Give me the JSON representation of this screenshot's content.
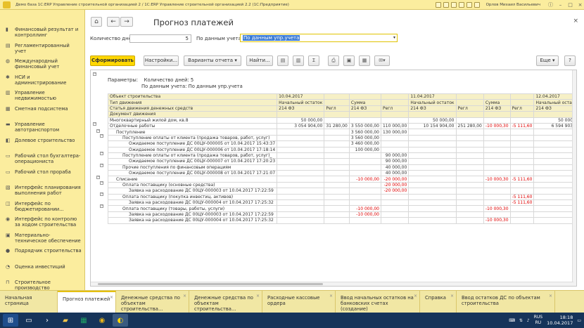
{
  "window": {
    "title": "Демо база 1С:ERP Управление строительной организацией 2 / 1С:ERP Управление строительной организацией 2.2 (1С:Предприятие)",
    "user": "Орлов Михаил Васильевич"
  },
  "sidebar": {
    "items": [
      {
        "label": "Финансовый результат и контроллинг",
        "icon": "chart-icon"
      },
      {
        "label": "Регламентированный учет",
        "icon": "ledger-icon"
      },
      {
        "label": "Международный финансовый учет",
        "icon": "globe-icon"
      },
      {
        "label": "НСИ и администрирование",
        "icon": "gear-icon"
      },
      {
        "label": "Управление недвижимостью",
        "icon": "building-icon"
      },
      {
        "label": "Сметная подсистема",
        "icon": "estimate-icon"
      },
      {
        "label": "Управление автотранспортом",
        "icon": "truck-icon"
      },
      {
        "label": "Долевое строительство",
        "icon": "share-icon"
      },
      {
        "label": "Рабочий стол бухгалтера-операциониста",
        "icon": "desk-icon"
      },
      {
        "label": "Рабочий стол прораба",
        "icon": "desk-icon"
      },
      {
        "label": "Интерфейс планирования выполнения работ",
        "icon": "plan-icon"
      },
      {
        "label": "Интерфейс по бюджетировании...",
        "icon": "budget-icon"
      },
      {
        "label": "Интерфейс по контролю за ходом строительства",
        "icon": "control-icon"
      },
      {
        "label": "Материально-техническое обеспечение",
        "icon": "box-icon"
      },
      {
        "label": "Подрядчик строительства",
        "icon": "person-icon"
      },
      {
        "label": "Оценка инвестиций",
        "icon": "invest-icon"
      },
      {
        "label": "Строительное производство",
        "icon": "crane-icon"
      }
    ]
  },
  "form": {
    "title": "Прогноз платежей",
    "days_label": "Количество дней:",
    "days_value": "5",
    "source_label": "По данным учета:",
    "source_value": "По данным упр.учета",
    "toolbar": {
      "generate": "Сформировать",
      "settings": "Настройки...",
      "variants": "Варианты отчета",
      "find": "Найти...",
      "more": "Еще",
      "help": "?"
    }
  },
  "report": {
    "params_label": "Параметры:",
    "param1": "Количество дней: 5",
    "param2": "По данным учета: По данным упр.учета",
    "header_rows": [
      [
        "Объект строительства",
        "10.04.2017",
        "",
        "",
        "",
        "11.04.2017",
        "",
        "",
        "",
        "12.04.2017",
        ""
      ],
      [
        "Тип движения",
        "Начальный остаток",
        "",
        "Сумма",
        "",
        "Начальный остаток",
        "",
        "Сумма",
        "",
        "Начальный остаток",
        ""
      ],
      [
        "Статья движения денежных средств",
        "214 ФЗ",
        "Регл",
        "214 ФЗ",
        "Регл",
        "214 ФЗ",
        "Регл",
        "214 ФЗ",
        "Регл",
        "214 ФЗ",
        "Регл"
      ],
      [
        "Документ движения",
        "",
        "",
        "",
        "",
        "",
        "",
        "",
        "",
        "",
        ""
      ]
    ],
    "rows": [
      {
        "indent": 0,
        "cells": [
          "Многоквартирный жилой дом, кв.8",
          "50 000,00",
          "",
          "",
          "",
          "50 000,00",
          "",
          "",
          "",
          "50 000,00",
          ""
        ]
      },
      {
        "indent": 0,
        "cells": [
          "Отделочные работы",
          "3 054 904,00",
          "31 280,00",
          "3 550 000,00",
          "110 000,00",
          "10 154 904,00",
          "251 280,00",
          "-10 000,30",
          "-5 111,60",
          "6 594 903,70",
          "5"
        ]
      },
      {
        "indent": 1,
        "cells": [
          "Поступление",
          "",
          "",
          "3 560 000,00",
          "130 000,00",
          "",
          "",
          "",
          "",
          "",
          ""
        ]
      },
      {
        "indent": 2,
        "cells": [
          "Поступление оплаты от клиента (продажа товаров, работ, услуг)",
          "",
          "",
          "3 560 000,00",
          "",
          "",
          "",
          "",
          "",
          "",
          ""
        ]
      },
      {
        "indent": 3,
        "cells": [
          "Ожидаемое поступление ДС 00ЦУ-000005 от 10.04.2017 15:43:37",
          "",
          "",
          "3 460 000,00",
          "",
          "",
          "",
          "",
          "",
          "",
          ""
        ]
      },
      {
        "indent": 3,
        "cells": [
          "Ожидаемое поступление ДС 00ЦУ-000006 от 10.04.2017 17:18:14",
          "",
          "",
          "100 000,00",
          "",
          "",
          "",
          "",
          "",
          "",
          ""
        ]
      },
      {
        "indent": 2,
        "cells": [
          "Поступление оплаты от клиента (продажа товаров, работ, услуг)_",
          "",
          "",
          "",
          "90 000,00",
          "",
          "",
          "",
          "",
          "",
          ""
        ]
      },
      {
        "indent": 3,
        "cells": [
          "Ожидаемое поступление ДС 00ЦУ-000007 от 10.04.2017 17:20:23",
          "",
          "",
          "",
          "90 000,00",
          "",
          "",
          "",
          "",
          "",
          ""
        ]
      },
      {
        "indent": 2,
        "cells": [
          "Прочие поступления по финансовым операциям",
          "",
          "",
          "",
          "40 000,00",
          "",
          "",
          "",
          "",
          "",
          ""
        ]
      },
      {
        "indent": 3,
        "cells": [
          "Ожидаемое поступление ДС 00ЦУ-000008 от 10.04.2017 17:21:07",
          "",
          "",
          "",
          "40 000,00",
          "",
          "",
          "",
          "",
          "",
          ""
        ]
      },
      {
        "indent": 1,
        "cells": [
          "Списание",
          "",
          "",
          "-10 000,00",
          "-20 000,00",
          "",
          "",
          "-10 000,30",
          "-5 111,60",
          "",
          ""
        ]
      },
      {
        "indent": 2,
        "cells": [
          "Оплата поставщику (основные средства)",
          "",
          "",
          "",
          "-20 000,00",
          "",
          "",
          "",
          "",
          "",
          ""
        ]
      },
      {
        "indent": 3,
        "cells": [
          "Заявка на расходование ДС 00ЦУ-000003 от 10.04.2017 17:22:59",
          "",
          "",
          "",
          "-20 000,00",
          "",
          "",
          "",
          "",
          "",
          ""
        ]
      },
      {
        "indent": 2,
        "cells": [
          "Оплата поставщику (покупка инвестиц. активов)",
          "",
          "",
          "",
          "",
          "",
          "",
          "",
          "-5 111,60",
          "",
          ""
        ]
      },
      {
        "indent": 3,
        "cells": [
          "Заявка на расходование ДС 00ЦУ-000004 от 10.04.2017 17:25:32",
          "",
          "",
          "",
          "",
          "",
          "",
          "",
          "-5 111,60",
          "",
          ""
        ]
      },
      {
        "indent": 2,
        "cells": [
          "Оплата поставщику (товары, работы, услуги)",
          "",
          "",
          "-10 000,00",
          "",
          "",
          "",
          "-10 000,30",
          "",
          "",
          ""
        ]
      },
      {
        "indent": 3,
        "cells": [
          "Заявка на расходование ДС 00ЦУ-000003 от 10.04.2017 17:22:59",
          "",
          "",
          "-10 000,00",
          "",
          "",
          "",
          "",
          "",
          "",
          ""
        ]
      },
      {
        "indent": 3,
        "cells": [
          "Заявка на расходование ДС 00ЦУ-000004 от 10.04.2017 17:25:32",
          "",
          "",
          "",
          "",
          "",
          "",
          "-10 000,30",
          "",
          "",
          ""
        ]
      }
    ]
  },
  "tabs": [
    {
      "label": "Начальная страница",
      "closable": false
    },
    {
      "label": "Прогноз платежей",
      "closable": true,
      "active": true
    },
    {
      "label": "Денежные средства по объектам строительства...",
      "closable": true
    },
    {
      "label": "Денежные средства по объектам строительства...",
      "closable": true
    },
    {
      "label": "Расходные кассовые ордера",
      "closable": true
    },
    {
      "label": "Ввод начальных остатков на банковских счетах (создание)",
      "closable": true
    },
    {
      "label": "Справка",
      "closable": true
    },
    {
      "label": "Ввод остатков ДС по объектам строительства",
      "closable": true
    }
  ],
  "taskbar": {
    "lang": "RUS",
    "lang2": "RU",
    "time": "18:18",
    "date": "10.04.2017"
  }
}
